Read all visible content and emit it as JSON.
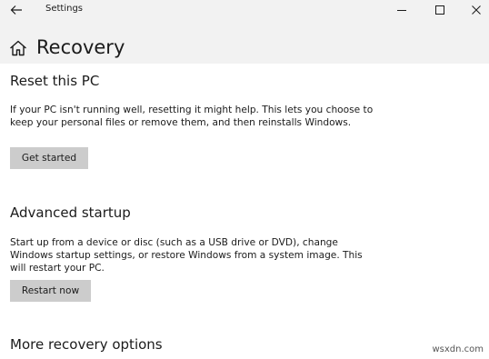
{
  "window": {
    "title": "Settings",
    "back_icon": "arrow-left-icon",
    "minimize_icon": "minimize-icon",
    "maximize_icon": "maximize-icon",
    "close_icon": "close-icon"
  },
  "header": {
    "home_icon": "home-icon",
    "page_title": "Recovery"
  },
  "sections": [
    {
      "heading": "Reset this PC",
      "description": "If your PC isn't running well, resetting it might help. This lets you choose to keep your personal files or remove them, and then reinstalls Windows.",
      "button_label": "Get started"
    },
    {
      "heading": "Advanced startup",
      "description": "Start up from a device or disc (such as a USB drive or DVD), change Windows startup settings, or restore Windows from a system image. This will restart your PC.",
      "button_label": "Restart now"
    },
    {
      "heading": "More recovery options"
    }
  ],
  "watermark": "wsxdn.com",
  "colors": {
    "header_background": "#f2f2f2",
    "button_background": "#cccccc",
    "text": "#1b1b1b"
  }
}
